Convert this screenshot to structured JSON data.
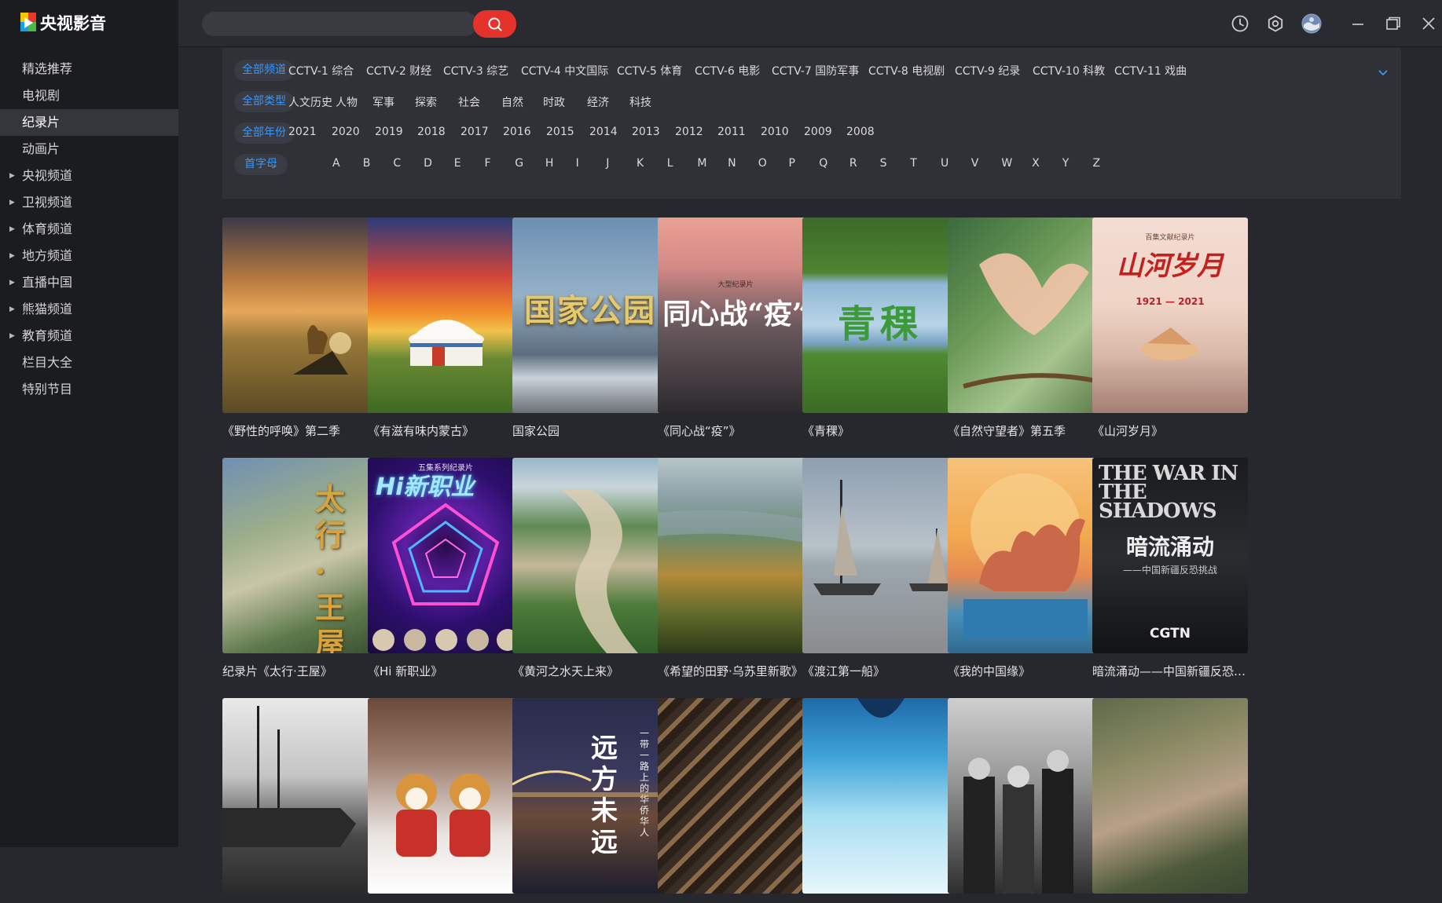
{
  "app": {
    "title": "央视影音"
  },
  "sidebar": {
    "items": [
      {
        "label": "精选推荐",
        "arrow": false,
        "active": false
      },
      {
        "label": "电视剧",
        "arrow": false,
        "active": false
      },
      {
        "label": "纪录片",
        "arrow": false,
        "active": true
      },
      {
        "label": "动画片",
        "arrow": false,
        "active": false
      },
      {
        "label": "央视频道",
        "arrow": true,
        "active": false
      },
      {
        "label": "卫视频道",
        "arrow": true,
        "active": false
      },
      {
        "label": "体育频道",
        "arrow": true,
        "active": false
      },
      {
        "label": "地方频道",
        "arrow": true,
        "active": false
      },
      {
        "label": "直播中国",
        "arrow": true,
        "active": false
      },
      {
        "label": "熊猫频道",
        "arrow": true,
        "active": false
      },
      {
        "label": "教育频道",
        "arrow": true,
        "active": false
      },
      {
        "label": "栏目大全",
        "arrow": false,
        "active": false
      },
      {
        "label": "特别节目",
        "arrow": false,
        "active": false
      }
    ]
  },
  "search": {
    "placeholder": "",
    "value": ""
  },
  "topbar": {
    "icons": [
      "search-icon",
      "history-clock-icon",
      "settings-gear-icon",
      "user-avatar-icon",
      "minimize-icon",
      "restore-window-icon",
      "close-icon"
    ]
  },
  "filters": {
    "channel": {
      "pill": "全部频道",
      "options": [
        "CCTV-1 综合",
        "CCTV-2 财经",
        "CCTV-3 综艺",
        "CCTV-4 中文国际",
        "CCTV-5 体育",
        "CCTV-6 电影",
        "CCTV-7 国防军事",
        "CCTV-8 电视剧",
        "CCTV-9 纪录",
        "CCTV-10 科教",
        "CCTV-11 戏曲"
      ]
    },
    "type": {
      "pill": "全部类型",
      "options": [
        "人文历史",
        "人物",
        "军事",
        "探索",
        "社会",
        "自然",
        "时政",
        "经济",
        "科技"
      ]
    },
    "year": {
      "pill": "全部年份",
      "options": [
        "2021",
        "2020",
        "2019",
        "2018",
        "2017",
        "2016",
        "2015",
        "2014",
        "2013",
        "2012",
        "2011",
        "2010",
        "2009",
        "2008"
      ]
    },
    "letter": {
      "pill": "首字母",
      "options": [
        "A",
        "B",
        "C",
        "D",
        "E",
        "F",
        "G",
        "H",
        "I",
        "J",
        "K",
        "L",
        "M",
        "N",
        "O",
        "P",
        "Q",
        "R",
        "S",
        "T",
        "U",
        "V",
        "W",
        "X",
        "Y",
        "Z"
      ]
    }
  },
  "cards": [
    {
      "title": "《野性的呼唤》第二季"
    },
    {
      "title": "《有滋有味内蒙古》"
    },
    {
      "title": "国家公园",
      "poster_text": "国家公园"
    },
    {
      "title": "《同心战“疫”》",
      "poster_text": "同心战“疫”",
      "poster_sub": "大型纪录片"
    },
    {
      "title": "《青稞》",
      "poster_text": "青稞"
    },
    {
      "title": "《自然守望者》第五季"
    },
    {
      "title": "《山河岁月》",
      "poster_text": "山河岁月",
      "poster_sub": "百集文献纪录片",
      "poster_years": "1921 — 2021"
    },
    {
      "title": "纪录片《太行·王屋》",
      "poster_text": "太行·王屋"
    },
    {
      "title": "《Hi 新职业》",
      "poster_text": "Hi新职业",
      "poster_sub": "五集系列纪录片"
    },
    {
      "title": "《黄河之水天上来》"
    },
    {
      "title": "《希望的田野·乌苏里新歌》"
    },
    {
      "title": "《渡江第一船》"
    },
    {
      "title": "《我的中国缘》"
    },
    {
      "title": "暗流涌动——中国新疆反恐挑战",
      "poster_text": "THE WAR IN THE SHADOWS",
      "poster_cn": "暗流涌动",
      "poster_sub": "——中国新疆反恐挑战",
      "poster_brand": "CGTN"
    },
    {
      "title": ""
    },
    {
      "title": ""
    },
    {
      "title": "",
      "poster_text": "远方未远",
      "poster_sub": "一带一路上的华侨华人"
    },
    {
      "title": ""
    },
    {
      "title": ""
    },
    {
      "title": ""
    },
    {
      "title": ""
    }
  ],
  "colors": {
    "accent": "#e5322b",
    "pill_text": "#3897ff",
    "bg": "#27282d",
    "sidebar": "#1b1c20"
  }
}
